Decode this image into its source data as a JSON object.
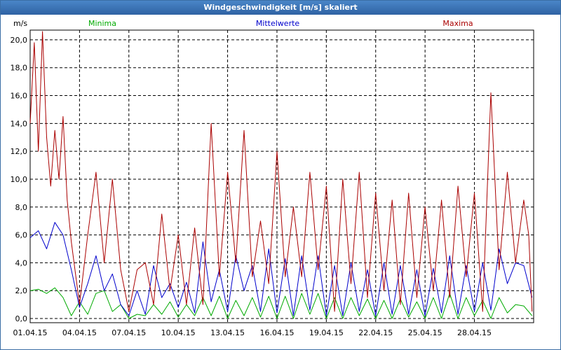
{
  "window": {
    "title": "Windgeschwindigkeit [m/s] skaliert"
  },
  "chart_data": {
    "type": "line",
    "title": "Windgeschwindigkeit [m/s] skaliert",
    "ylabel": "m/s",
    "xlabel": "",
    "ylim": [
      0,
      21
    ],
    "yticks": [
      0,
      2,
      4,
      6,
      8,
      10,
      12,
      14,
      16,
      18,
      20
    ],
    "yticklabels": [
      "0,0",
      "2,0",
      "4,0",
      "6,0",
      "8,0",
      "10,0",
      "12,0",
      "14,0",
      "16,0",
      "18,0",
      "20,0"
    ],
    "xlim_days": [
      0,
      30.6
    ],
    "xticks_days": [
      0,
      3,
      6,
      9,
      12,
      15,
      18,
      21,
      24,
      27
    ],
    "xticklabels": [
      "01.04.15",
      "04.04.15",
      "07.04.15",
      "10.04.15",
      "13.04.15",
      "16.04.15",
      "19.04.15",
      "22.04.15",
      "25.04.15",
      "28.04.15"
    ],
    "grid": true,
    "legend_position": "top",
    "series": [
      {
        "name": "Minima",
        "color": "#00aa00",
        "x": [
          0,
          0.5,
          1,
          1.5,
          2,
          2.5,
          3,
          3.5,
          4,
          4.5,
          5,
          5.5,
          6,
          6.5,
          7,
          7.5,
          8,
          8.5,
          9,
          9.5,
          10,
          10.5,
          11,
          11.5,
          12,
          12.5,
          13,
          13.5,
          14,
          14.5,
          15,
          15.5,
          16,
          16.5,
          17,
          17.5,
          18,
          18.5,
          19,
          19.5,
          20,
          20.5,
          21,
          21.5,
          22,
          22.5,
          23,
          23.5,
          24,
          24.5,
          25,
          25.5,
          26,
          26.5,
          27,
          27.5,
          28,
          28.5,
          29,
          29.5,
          30,
          30.5
        ],
        "y": [
          2.0,
          2.1,
          1.8,
          2.2,
          1.5,
          0.2,
          1.2,
          0.3,
          1.8,
          2.0,
          0.5,
          1.0,
          0.0,
          0.3,
          0.2,
          1.0,
          0.3,
          1.2,
          0.1,
          1.0,
          0.2,
          1.5,
          0.2,
          1.6,
          0.0,
          1.3,
          0.2,
          1.5,
          0.1,
          1.6,
          0.0,
          1.6,
          0.0,
          1.8,
          0.3,
          1.8,
          0.0,
          1.5,
          0.0,
          1.5,
          0.2,
          1.4,
          0.0,
          1.3,
          0.0,
          1.4,
          0.1,
          1.2,
          0.0,
          1.5,
          0.0,
          1.8,
          0.0,
          1.5,
          0.2,
          1.3,
          0.0,
          1.5,
          0.4,
          1.0,
          0.9,
          0.2
        ]
      },
      {
        "name": "Mittelwerte",
        "color": "#0000cc",
        "x": [
          0,
          0.5,
          1,
          1.5,
          2,
          2.5,
          3,
          3.5,
          4,
          4.5,
          5,
          5.5,
          6,
          6.5,
          7,
          7.5,
          8,
          8.5,
          9,
          9.5,
          10,
          10.5,
          11,
          11.5,
          12,
          12.5,
          13,
          13.5,
          14,
          14.5,
          15,
          15.5,
          16,
          16.5,
          17,
          17.5,
          18,
          18.5,
          19,
          19.5,
          20,
          20.5,
          21,
          21.5,
          22,
          22.5,
          23,
          23.5,
          24,
          24.5,
          25,
          25.5,
          26,
          26.5,
          27,
          27.5,
          28,
          28.5,
          29,
          29.5,
          30,
          30.5
        ],
        "y": [
          5.8,
          6.3,
          5.0,
          6.9,
          6.0,
          3.5,
          0.8,
          2.5,
          4.5,
          2.0,
          3.2,
          1.0,
          0.2,
          2.0,
          0.3,
          3.8,
          1.5,
          2.5,
          0.8,
          2.6,
          0.4,
          5.5,
          1.2,
          3.5,
          0.5,
          4.5,
          2.0,
          3.8,
          0.5,
          5.0,
          0.4,
          4.3,
          0.2,
          4.5,
          0.6,
          4.5,
          0.2,
          3.8,
          0.2,
          4.0,
          0.5,
          3.5,
          0.2,
          4.0,
          0.3,
          3.8,
          0.3,
          3.5,
          0.2,
          3.6,
          0.4,
          4.5,
          0.3,
          3.8,
          0.5,
          4.0,
          0.6,
          5.0,
          2.5,
          4.0,
          3.8,
          1.5
        ]
      },
      {
        "name": "Maxima",
        "color": "#aa0000",
        "x": [
          0,
          0.25,
          0.5,
          0.75,
          1,
          1.25,
          1.5,
          1.75,
          2,
          2.25,
          2.5,
          3,
          3.5,
          4,
          4.5,
          5,
          5.5,
          6,
          6.5,
          7,
          7.5,
          8,
          8.5,
          9,
          9.5,
          10,
          10.5,
          11,
          11.5,
          12,
          12.5,
          13,
          13.5,
          14,
          14.5,
          15,
          15.5,
          16,
          16.5,
          17,
          17.5,
          18,
          18.5,
          19,
          19.5,
          20,
          20.5,
          21,
          21.5,
          22,
          22.5,
          23,
          23.5,
          24,
          24.5,
          25,
          25.5,
          26,
          26.5,
          27,
          27.5,
          28,
          28.5,
          29,
          29.5,
          30,
          30.3,
          30.5
        ],
        "y": [
          14.0,
          19.8,
          12.0,
          20.6,
          13.0,
          9.5,
          13.5,
          10.0,
          14.5,
          8.5,
          5.5,
          1.0,
          6.0,
          10.5,
          4.0,
          10.0,
          3.5,
          0.5,
          3.5,
          4.0,
          1.0,
          7.5,
          2.0,
          6.0,
          1.0,
          6.5,
          1.0,
          14.0,
          3.0,
          10.5,
          4.0,
          13.5,
          3.0,
          7.0,
          2.5,
          12.0,
          3.0,
          8.0,
          3.0,
          10.5,
          3.5,
          9.5,
          0.5,
          10.0,
          2.5,
          10.5,
          1.5,
          9.0,
          2.0,
          8.5,
          1.0,
          9.0,
          1.5,
          8.0,
          2.0,
          8.5,
          1.5,
          9.5,
          3.0,
          9.0,
          0.5,
          16.2,
          3.5,
          10.5,
          4.0,
          8.5,
          6.0,
          0.5
        ]
      }
    ]
  }
}
